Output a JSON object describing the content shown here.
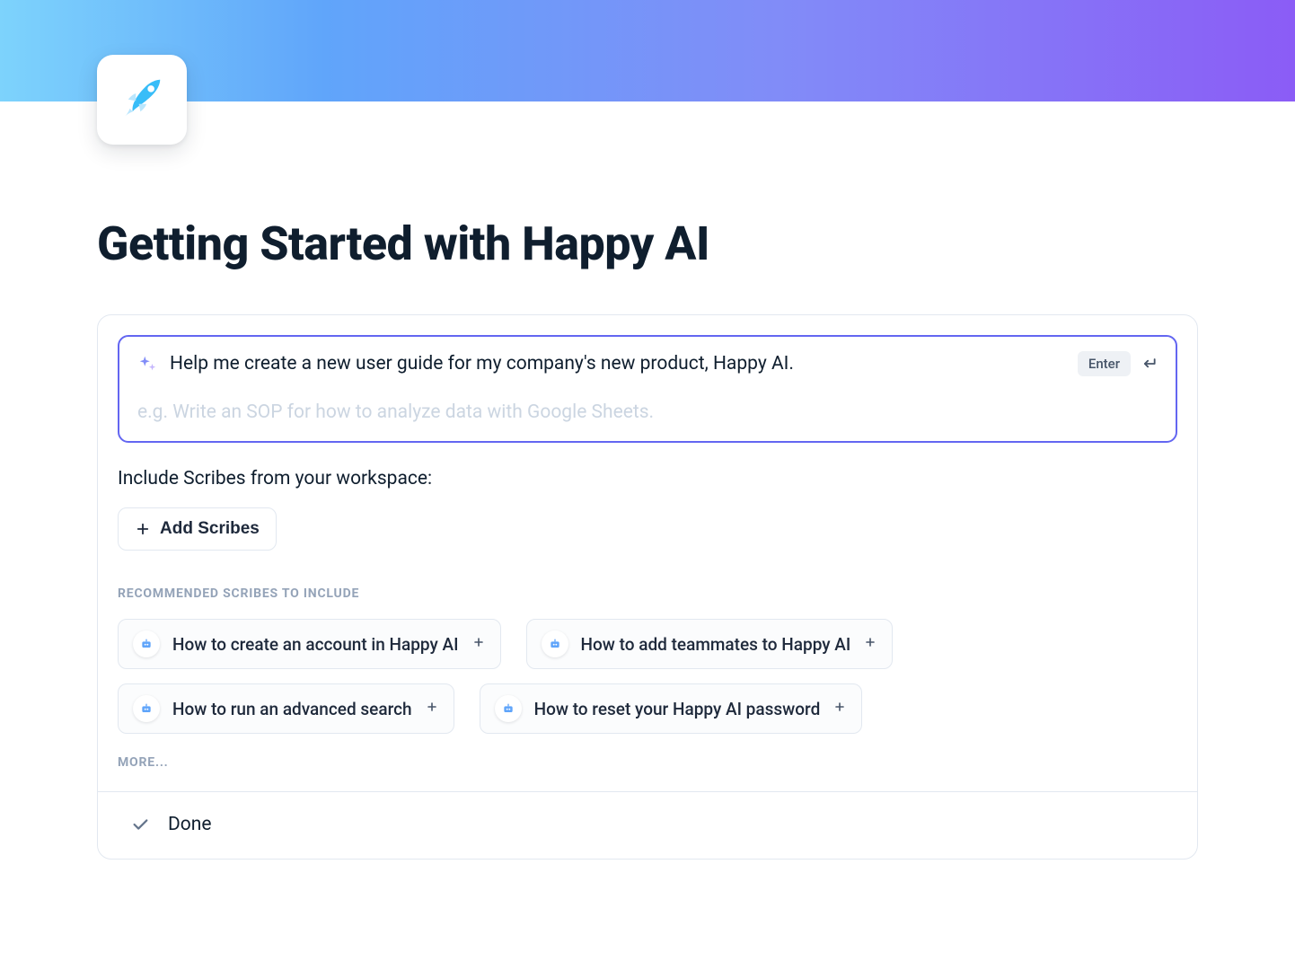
{
  "page": {
    "title": "Getting Started with Happy AI"
  },
  "prompt": {
    "text": "Help me create a new user guide for my company's new product, Happy AI.",
    "placeholder": "e.g. Write an SOP for how to analyze data with Google Sheets.",
    "enter_label": "Enter"
  },
  "include": {
    "label": "Include Scribes from your workspace:",
    "add_button": "Add Scribes"
  },
  "recommended": {
    "heading": "RECOMMENDED SCRIBES TO INCLUDE",
    "items": [
      {
        "label": "How to create an account in Happy AI"
      },
      {
        "label": "How to add teammates to Happy AI"
      },
      {
        "label": "How to run an advanced search"
      },
      {
        "label": "How to reset your Happy AI password"
      }
    ],
    "more_label": "MORE..."
  },
  "done": {
    "label": "Done"
  },
  "colors": {
    "accent": "#6366f1",
    "icon_blue": "#38bdf8",
    "text_primary": "#0f1e2e",
    "text_muted": "#94a3b8"
  }
}
